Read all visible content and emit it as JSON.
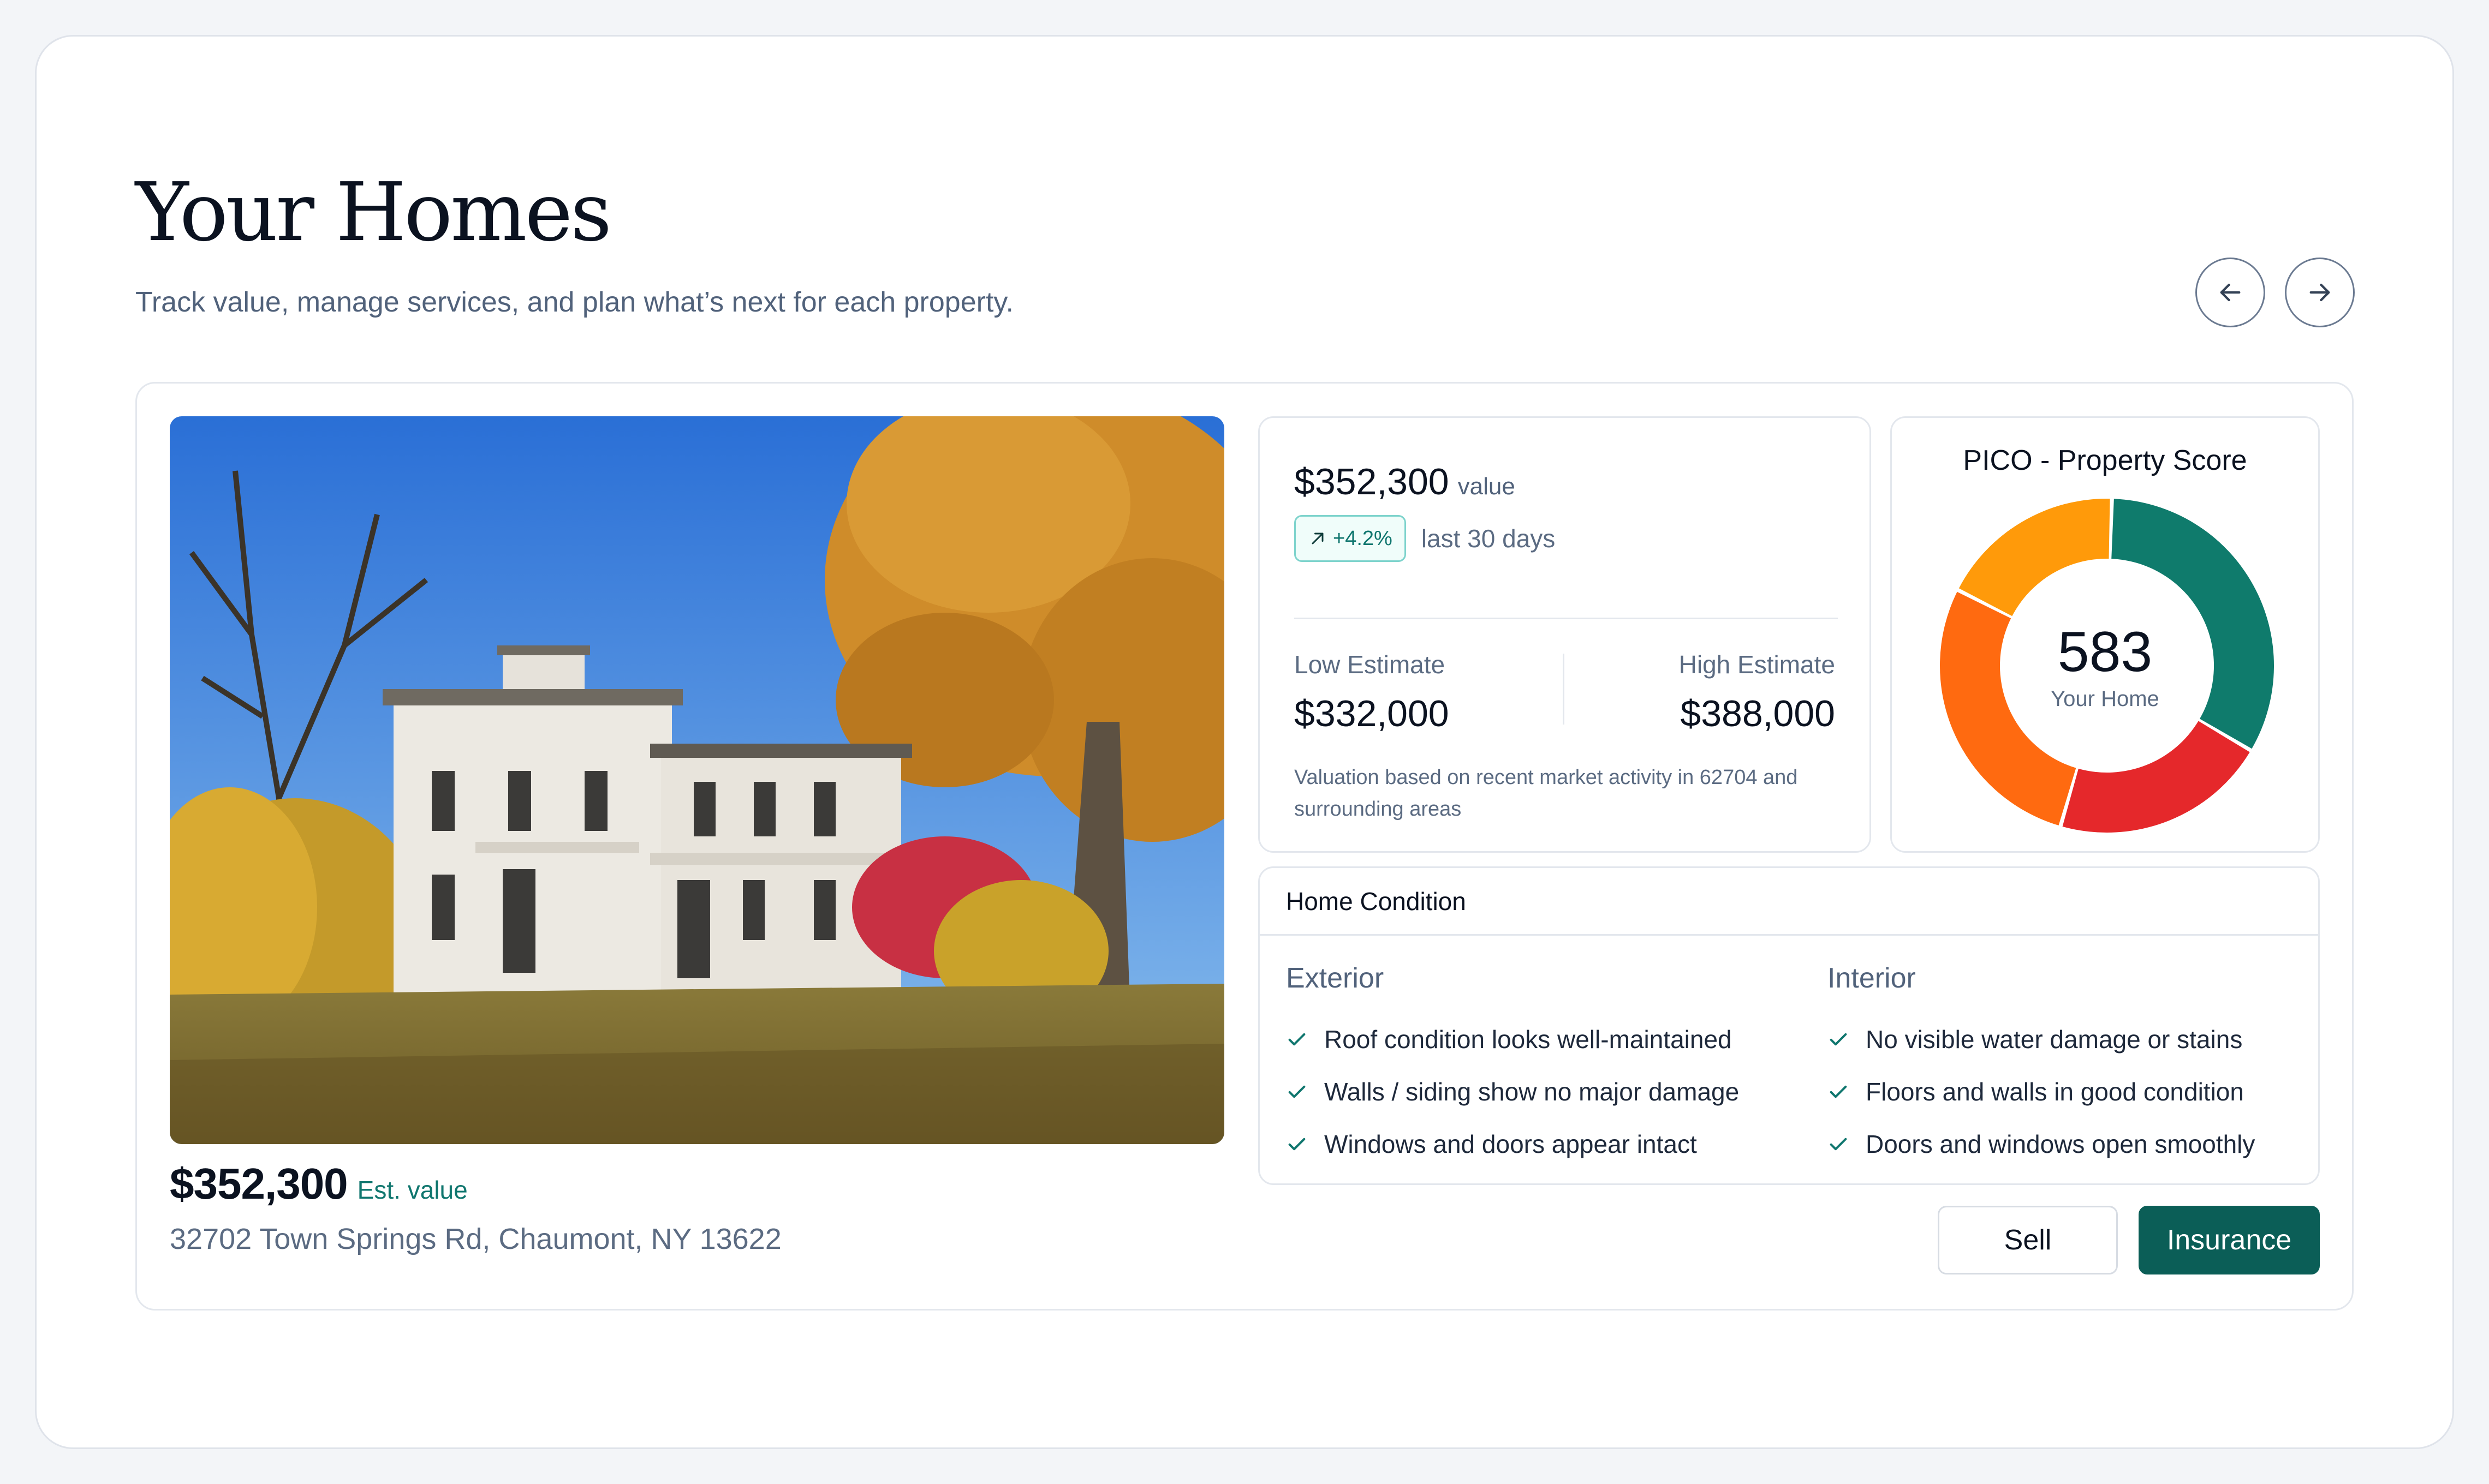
{
  "header": {
    "title": "Your Homes",
    "subtitle": "Track value, manage services, and plan what’s next for each property."
  },
  "nav": {
    "prev_icon": "arrow-left-icon",
    "next_icon": "arrow-right-icon"
  },
  "property": {
    "est_value": "$352,300",
    "est_label": "Est. value",
    "address": "32702 Town Springs Rd, Chaumont, NY 13622"
  },
  "valuation": {
    "value": "$352,300",
    "value_label": "value",
    "change": "+4.2%",
    "change_icon": "trend-up-arrow-icon",
    "change_period": "last 30 days",
    "low_label": "Low Estimate",
    "low_value": "$332,000",
    "high_label": "High Estimate",
    "high_value": "$388,000",
    "note": "Valuation based on recent market activity in 62704 and surrounding areas"
  },
  "score": {
    "title": "PICO - Property Score",
    "value": "583",
    "subtitle": "Your Home",
    "segments": [
      {
        "color": "#0f7b6c",
        "share": 0.33
      },
      {
        "color": "#e5282b",
        "share": 0.21
      },
      {
        "color": "#ff6a10",
        "share": 0.28
      },
      {
        "color": "#ff9a0a",
        "share": 0.18
      }
    ]
  },
  "condition": {
    "title": "Home Condition",
    "exterior": {
      "heading": "Exterior",
      "items": [
        "Roof condition looks well-maintained",
        "Walls / siding show no major damage",
        "Windows and doors appear intact"
      ]
    },
    "interior": {
      "heading": "Interior",
      "items": [
        "No visible water damage or stains",
        "Floors and walls in good condition",
        "Doors and windows open smoothly"
      ]
    }
  },
  "actions": {
    "sell": "Sell",
    "insurance": "Insurance"
  },
  "colors": {
    "accent": "#0b5e57",
    "accent_text": "#0f766e",
    "muted_text": "#5b6b82"
  }
}
